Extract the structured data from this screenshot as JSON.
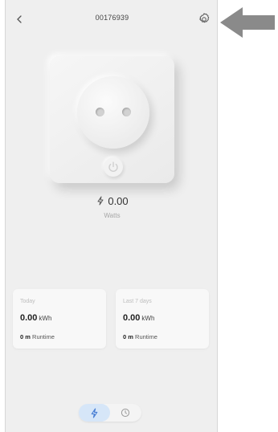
{
  "header": {
    "title": "00176939",
    "back_icon": "chevron-left-icon",
    "settings_icon": "gear-icon"
  },
  "device": {
    "power_value": "0.00",
    "power_unit": "Watts"
  },
  "stats": {
    "today": {
      "label": "Today",
      "value": "0.00",
      "unit": "kWh",
      "runtime_value": "0 m",
      "runtime_label": "Runtime"
    },
    "week": {
      "label": "Last 7 days",
      "value": "0.00",
      "unit": "kWh",
      "runtime_value": "0 m",
      "runtime_label": "Runtime"
    }
  },
  "tabs": [
    {
      "icon": "lightning-icon",
      "active": true
    },
    {
      "icon": "clock-icon",
      "active": false
    }
  ],
  "colors": {
    "background": "#efefef",
    "card": "#f8f8f8",
    "active_tab": "#d6e6f8",
    "accent_blue": "#4a7fd4",
    "annotation_arrow": "#8a8a8a"
  }
}
